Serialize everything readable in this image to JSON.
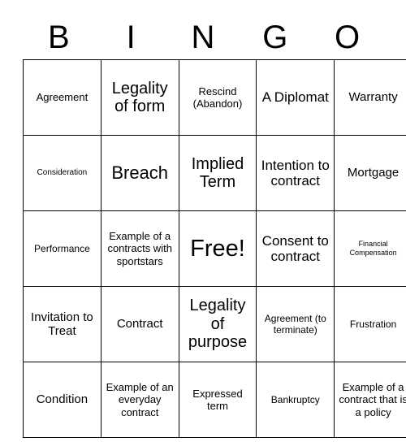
{
  "card": {
    "title": "BINGO",
    "header_letters": [
      "B",
      "I",
      "N",
      "G",
      "O"
    ],
    "columns": 5,
    "rows": 5,
    "free_space": {
      "row": 2,
      "col": 2,
      "label": "Free!"
    },
    "border_color": "#000000",
    "background_color": "#ffffff",
    "text_color": "#000000",
    "cells": [
      [
        {
          "label": "Agreement",
          "size": "sz-lg"
        },
        {
          "label": "Legality of form",
          "size": "sz-3xl"
        },
        {
          "label": "Rescind (Abandon)",
          "size": "sz-lg"
        },
        {
          "label": "A Diplomat",
          "size": "sz-2xl"
        },
        {
          "label": "Warranty",
          "size": "sz-xl"
        }
      ],
      [
        {
          "label": "Consideration",
          "size": "sz-sm"
        },
        {
          "label": "Breach",
          "size": "sz-4xl"
        },
        {
          "label": "Implied Term",
          "size": "sz-3xl"
        },
        {
          "label": "Intention to contract",
          "size": "sz-2xl"
        },
        {
          "label": "Mortgage",
          "size": "sz-xl"
        }
      ],
      [
        {
          "label": "Performance",
          "size": "sz-md"
        },
        {
          "label": "Example of a contracts with sportstars",
          "size": "sz-lg"
        },
        {
          "label": "Free!",
          "size": "sz-free"
        },
        {
          "label": "Consent to contract",
          "size": "sz-2xl"
        },
        {
          "label": "Financial Compensation",
          "size": "sz-xs"
        }
      ],
      [
        {
          "label": "Invitation to Treat",
          "size": "sz-xl"
        },
        {
          "label": "Contract",
          "size": "sz-xl"
        },
        {
          "label": "Legality of purpose",
          "size": "sz-3xl"
        },
        {
          "label": "Agreement (to terminate)",
          "size": "sz-md"
        },
        {
          "label": "Frustration",
          "size": "sz-md"
        }
      ],
      [
        {
          "label": "Condition",
          "size": "sz-xl"
        },
        {
          "label": "Example of an everyday contract",
          "size": "sz-lg"
        },
        {
          "label": "Expressed term",
          "size": "sz-lg"
        },
        {
          "label": "Bankruptcy",
          "size": "sz-md"
        },
        {
          "label": "Example of a contract that is a policy",
          "size": "sz-lg"
        }
      ]
    ]
  }
}
